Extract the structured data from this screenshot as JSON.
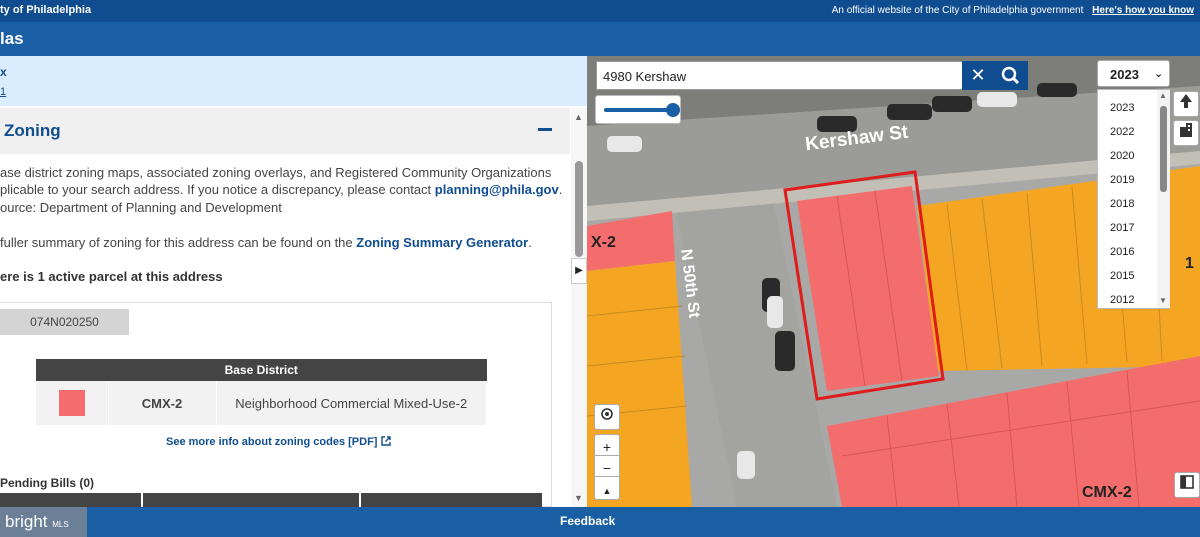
{
  "gov_bar": {
    "site_name": "ty of Philadelphia",
    "official_text": "An official website of the City of Philadelphia government",
    "how_link": "Here's how you know"
  },
  "app": {
    "title": "las"
  },
  "address_card": {
    "line1": "x",
    "line2": "1"
  },
  "zoning": {
    "heading": "Zoning",
    "desc_line1": "ase district zoning maps, associated zoning overlays, and Registered Community Organizations",
    "desc_line2_pre": "plicable to your search address. If you notice a discrepancy, please contact ",
    "email": "planning@phila.gov",
    "desc_line2_post": ".",
    "desc_line3": "ource: Department of Planning and Development",
    "summary_pre": "fuller summary of zoning for this address can be found on the ",
    "summary_link": "Zoning Summary Generator",
    "summary_post": ".",
    "parcel_count": "ere is 1 active parcel at this address",
    "parcel_tab": "074N020250",
    "table_header": "Base District",
    "code": "CMX-2",
    "description": "Neighborhood Commercial Mixed-Use-2",
    "swatch_color": "#f46d6d",
    "more_info": "See more info about zoning codes [PDF]",
    "pending_title": "Pending Bills (0)"
  },
  "map": {
    "search_value": "4980 Kershaw",
    "year_selected": "2023",
    "years": [
      "2023",
      "2022",
      "2020",
      "2019",
      "2018",
      "2017",
      "2016",
      "2015",
      "2012"
    ],
    "street_kershaw": "Kershaw St",
    "street_50th": "N 50th St",
    "zone_label_left": "X-2",
    "zone_label_bottom": "CMX-2",
    "zone_label_right": "1"
  },
  "footer": {
    "feedback": "Feedback",
    "watermark": "bright",
    "watermark_suffix": "MLS"
  }
}
